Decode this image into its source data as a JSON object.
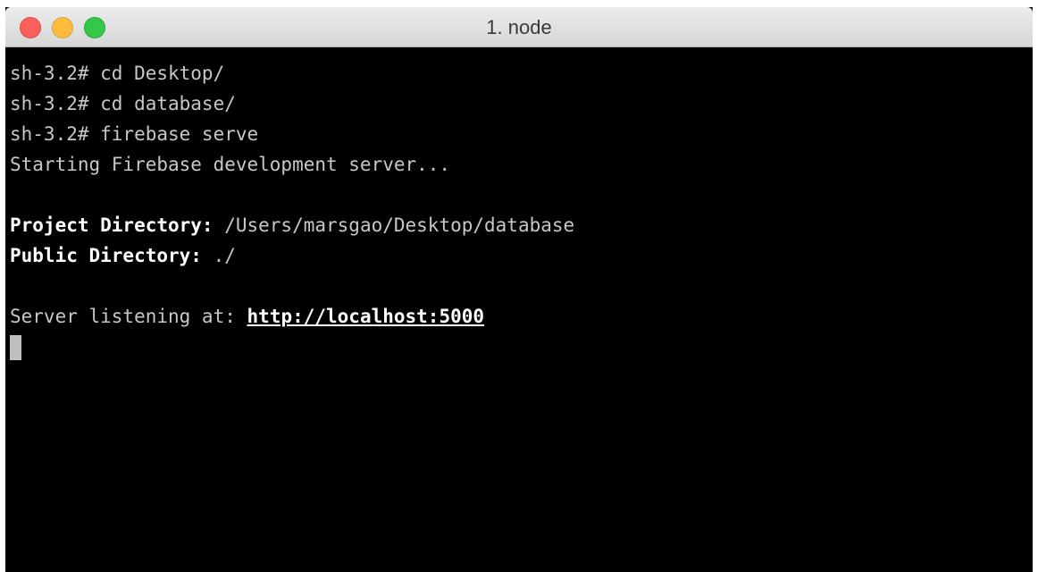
{
  "window": {
    "title": "1. node"
  },
  "terminal": {
    "lines": [
      "sh-3.2# cd Desktop/",
      "sh-3.2# cd database/",
      "sh-3.2# firebase serve",
      "Starting Firebase development server..."
    ],
    "project_dir_label": "Project Directory:",
    "project_dir_value": " /Users/marsgao/Desktop/database",
    "public_dir_label": "Public Directory:",
    "public_dir_value": " ./",
    "server_prefix": "Server listening at: ",
    "server_url": "http://localhost:5000"
  },
  "colors": {
    "background": "#000000",
    "text": "#c7c7c7",
    "bold_text": "#ffffff",
    "close": "#fc605c",
    "minimize": "#fdbc40",
    "zoom": "#34c84a"
  }
}
